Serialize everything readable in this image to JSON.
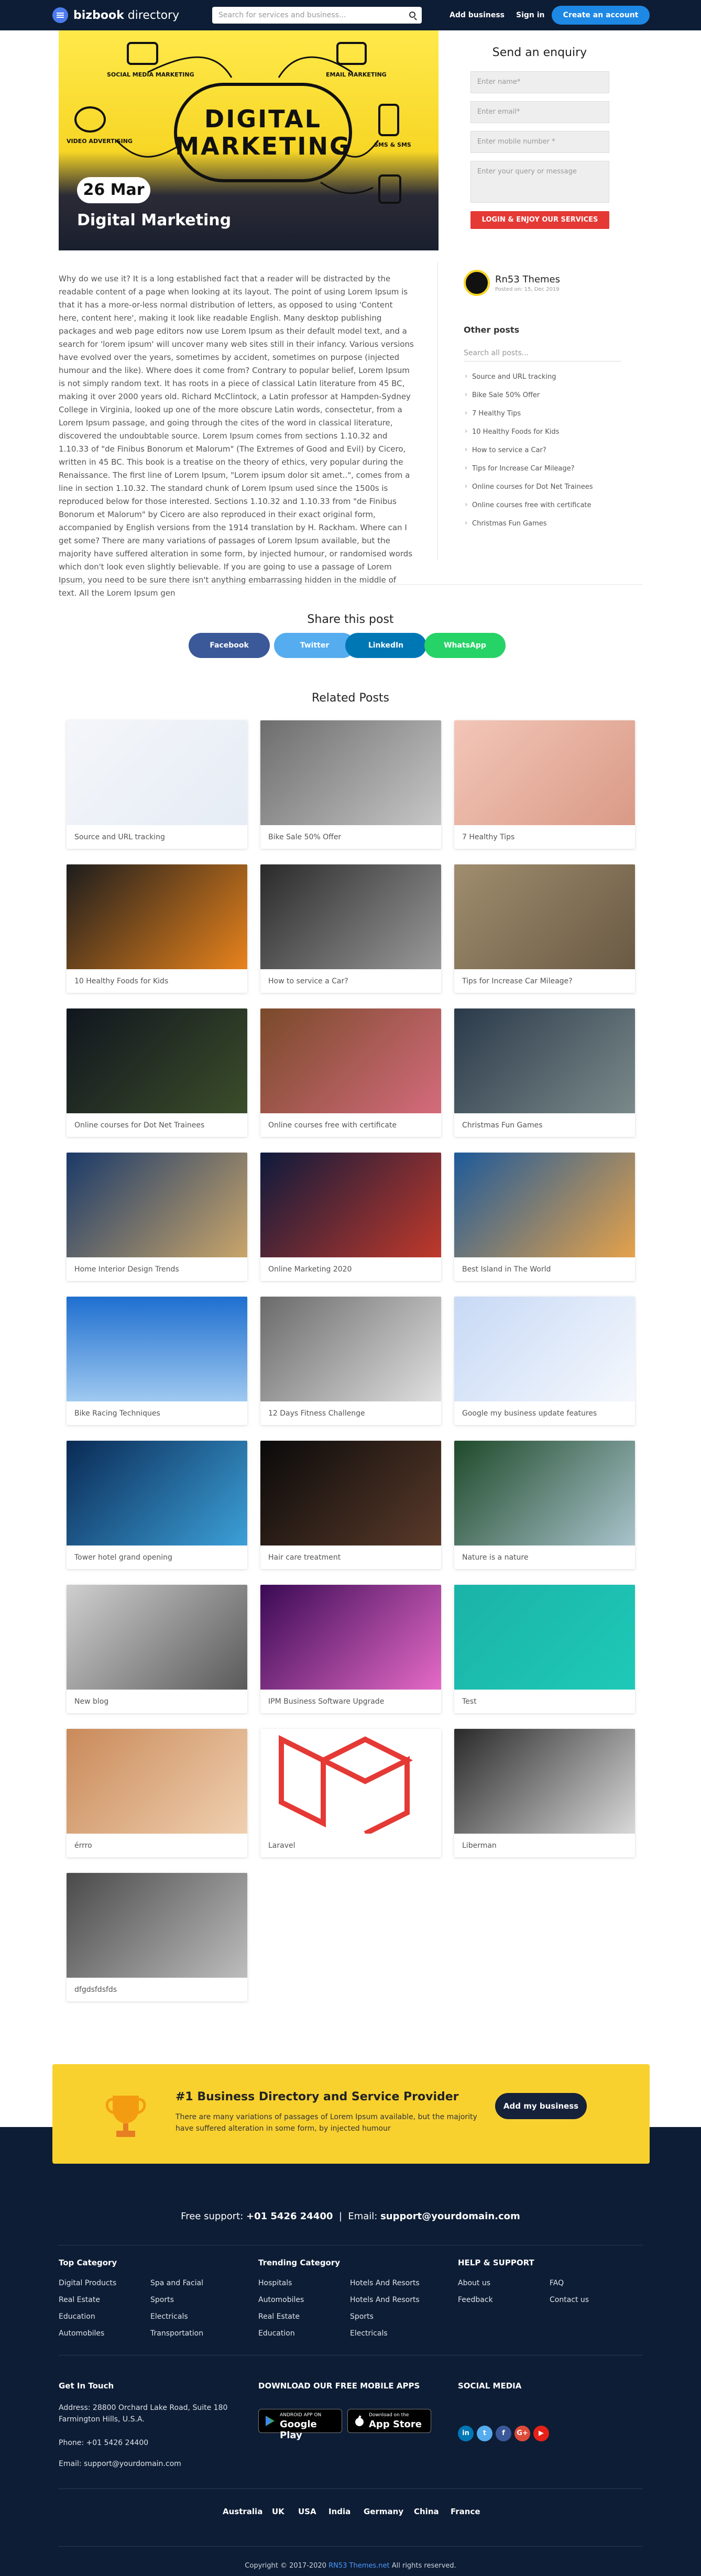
{
  "header": {
    "brand_bold": "bizbook",
    "brand_light": " directory",
    "search_placeholder": "Search for services and business...",
    "add_business": "Add business",
    "signin": "Sign in",
    "create_account": "Create an account"
  },
  "hero": {
    "center_line1": "DIGITAL",
    "center_line2": "MARKETING",
    "labels": [
      "SOCIAL MEDIA MARKETING",
      "EMAIL MARKETING",
      "VIDEO ADVERTISING",
      "SMS & SMS"
    ],
    "date": "26 Mar",
    "title": "Digital Marketing"
  },
  "enquiry": {
    "title": "Send an enquiry",
    "name_placeholder": "Enter name*",
    "email_placeholder": "Enter email*",
    "mobile_placeholder": "Enter mobile number *",
    "query_placeholder": "Enter your query or message",
    "submit": "LOGIN & ENJOY OUR SERVICES"
  },
  "article_text": "Why do we use it? It is a long established fact that a reader will be distracted by the readable content of a page when looking at its layout. The point of using Lorem Ipsum is that it has a more-or-less normal distribution of letters, as opposed to using 'Content here, content here', making it look like readable English. Many desktop publishing packages and web page editors now use Lorem Ipsum as their default model text, and a search for 'lorem ipsum' will uncover many web sites still in their infancy. Various versions have evolved over the years, sometimes by accident, sometimes on purpose (injected humour and the like). Where does it come from? Contrary to popular belief, Lorem Ipsum is not simply random text. It has roots in a piece of classical Latin literature from 45 BC, making it over 2000 years old. Richard McClintock, a Latin professor at Hampden-Sydney College in Virginia, looked up one of the more obscure Latin words, consectetur, from a Lorem Ipsum passage, and going through the cites of the word in classical literature, discovered the undoubtable source. Lorem Ipsum comes from sections 1.10.32 and 1.10.33 of \"de Finibus Bonorum et Malorum\" (The Extremes of Good and Evil) by Cicero, written in 45 BC. This book is a treatise on the theory of ethics, very popular during the Renaissance. The first line of Lorem Ipsum, \"Lorem ipsum dolor sit amet..\", comes from a line in section 1.10.32. The standard chunk of Lorem Ipsum used since the 1500s is reproduced below for those interested. Sections 1.10.32 and 1.10.33 from \"de Finibus Bonorum et Malorum\" by Cicero are also reproduced in their exact original form, accompanied by English versions from the 1914 translation by H. Rackham. Where can I get some? There are many variations of passages of Lorem Ipsum available, but the majority have suffered alteration in some form, by injected humour, or randomised words which don't look even slightly believable. If you are going to use a passage of Lorem Ipsum, you need to be sure there isn't anything embarrassing hidden in the middle of text. All the Lorem Ipsum gen",
  "sidebar": {
    "author_name": "Rn53 Themes",
    "author_date": "Posted on: 15, Dec 2019",
    "other_title": "Other posts",
    "search_placeholder": "Search all posts...",
    "posts": [
      "Source and URL tracking",
      "Bike Sale 50% Offer",
      "7 Healthy Tips",
      "10 Healthy Foods for Kids",
      "How to service a Car?",
      "Tips for Increase Car Mileage?",
      "Online courses for Dot Net Trainees",
      "Online courses free with certificate",
      "Christmas Fun Games"
    ]
  },
  "share": {
    "title": "Share this post",
    "facebook": "Facebook",
    "twitter": "Twitter",
    "linkedin": "LinkedIn",
    "whatsapp": "WhatsApp"
  },
  "related": {
    "title": "Related Posts",
    "items": [
      "Source and URL tracking",
      "Bike Sale 50% Offer",
      "7 Healthy Tips",
      "10 Healthy Foods for Kids",
      "How to service a Car?",
      "Tips for Increase Car Mileage?",
      "Online courses for Dot Net Trainees",
      "Online courses free with certificate",
      "Christmas Fun Games",
      "Home Interior Design Trends",
      "Online Marketing 2020",
      "Best Island in The World",
      "Bike Racing Techniques",
      "12 Days Fitness Challenge",
      "Google my business update features",
      "Tower hotel grand opening",
      "Hair care treatment",
      "Nature is a nature",
      "New blog",
      "IPM Business Software Upgrade",
      "Test",
      "érrro",
      "Laravel",
      "Liberman",
      "dfgdsfdsfds"
    ]
  },
  "banner": {
    "title": "#1 Business Directory and Service Provider",
    "text": "There are many variations of passages of Lorem Ipsum available, but the majority have suffered alteration in some form, by injected humour",
    "button": "Add my business"
  },
  "footer": {
    "support_label": "Free support:",
    "support_phone": "+01 5426 24400",
    "email_label": "Email:",
    "email_value": "support@yourdomain.com",
    "top_category": {
      "title": "Top Category",
      "items": [
        "Digital Products",
        "Real Estate",
        "Education",
        "Automobiles",
        "Spa and Facial",
        "Sports",
        "Electricals",
        "Transportation"
      ]
    },
    "trending_category": {
      "title": "Trending Category",
      "items": [
        "Hospitals",
        "Automobiles",
        "Real Estate",
        "Education",
        "Hotels And Resorts",
        "Hotels And Resorts",
        "Sports",
        "Electricals"
      ]
    },
    "help": {
      "title": "HELP & SUPPORT",
      "items": [
        "About us",
        "Feedback",
        "FAQ",
        "Contact us"
      ]
    },
    "get_in_touch": {
      "title": "Get In Touch",
      "address": "Address: 28800 Orchard Lake Road, Suite 180 Farmington Hills, U.S.A.",
      "phone": "Phone: +01 5426 24400",
      "email": "Email: support@yourdomain.com"
    },
    "apps": {
      "title": "DOWNLOAD OUR FREE MOBILE APPS",
      "google_small": "ANDROID APP ON",
      "google_big": "Google Play",
      "apple_small": "Download on the",
      "apple_big": "App Store"
    },
    "social": {
      "title": "SOCIAL MEDIA",
      "icons": [
        "in",
        "t",
        "f",
        "G+",
        "▶"
      ]
    },
    "countries": [
      "Australia",
      "UK",
      "USA",
      "India",
      "Germany",
      "China",
      "France"
    ],
    "copyright_pre": "Copyright © 2017-2020 ",
    "copyright_link": "RN53 Themes.net",
    "copyright_post": " All rights reserved."
  }
}
